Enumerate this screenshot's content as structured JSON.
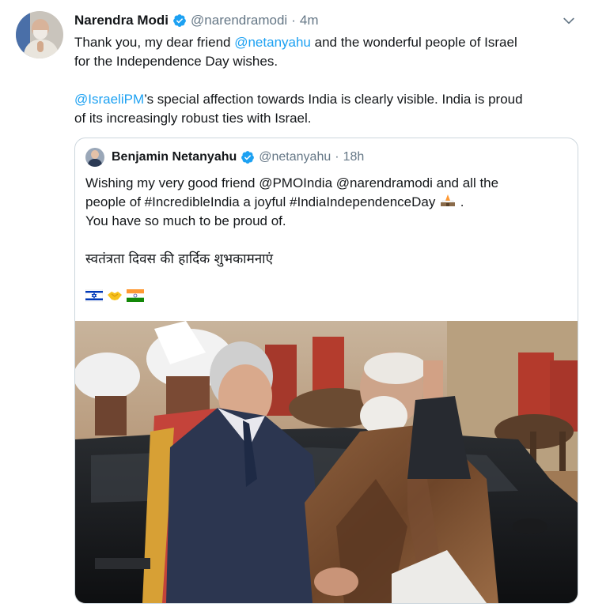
{
  "tweet": {
    "author_name": "Narendra Modi",
    "handle": "@narendramodi",
    "separator": "·",
    "time": "4m",
    "para1": {
      "line1_pre": "Thank you, my dear friend ",
      "line1_mention": "@netanyahu",
      "line1_post": " and the wonderful people of Israel",
      "line2": "for the Independence Day wishes."
    },
    "para2": {
      "line1_mention": "@IsraeliPM",
      "line1_post": "’s special affection towards India is clearly visible. India is proud",
      "line2": "of its increasingly robust ties with Israel."
    }
  },
  "quoted": {
    "author_name": "Benjamin Netanyahu",
    "handle": "@netanyahu",
    "separator": "·",
    "time": "18h",
    "line1": "Wishing my very good friend @PMOIndia @narendramodi and all the",
    "line2": "people of #IncredibleIndia a joyful #IndiaIndependenceDay",
    "line2_end": " .",
    "line3": "You have so much to be proud of.",
    "hindi": "स्वतंत्रता दिवस की हार्दिक शुभकामनाएं",
    "emojis": [
      "israel-flag",
      "handshake",
      "india-flag"
    ]
  },
  "colors": {
    "link": "#1da1f2",
    "muted": "#657786",
    "verified": "#1da1f2",
    "border": "#ccd6dd"
  }
}
